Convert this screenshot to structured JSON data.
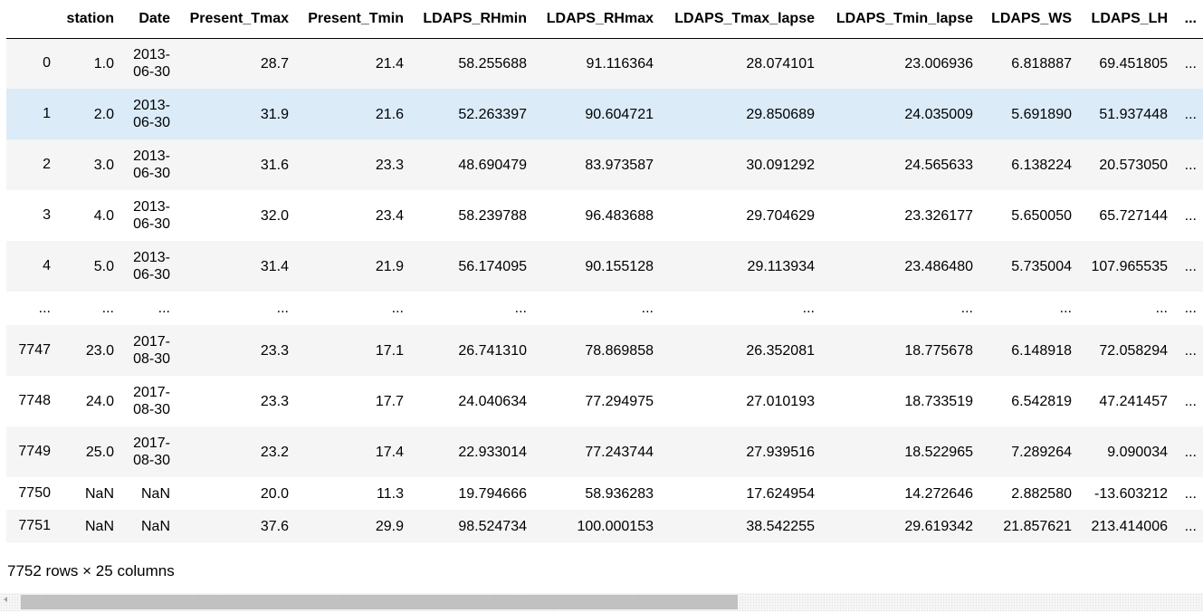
{
  "table": {
    "columns": [
      "station",
      "Date",
      "Present_Tmax",
      "Present_Tmin",
      "LDAPS_RHmin",
      "LDAPS_RHmax",
      "LDAPS_Tmax_lapse",
      "LDAPS_Tmin_lapse",
      "LDAPS_WS",
      "LDAPS_LH",
      "..."
    ],
    "rows": [
      {
        "index": "0",
        "station": "1.0",
        "date1": "2013-",
        "date2": "06-30",
        "tmax": "28.7",
        "tmin": "21.4",
        "rhmin": "58.255688",
        "rhmax": "91.116364",
        "tmaxl": "28.074101",
        "tminl": "23.006936",
        "ws": "6.818887",
        "lh": "69.451805",
        "more": "..."
      },
      {
        "index": "1",
        "station": "2.0",
        "date1": "2013-",
        "date2": "06-30",
        "tmax": "31.9",
        "tmin": "21.6",
        "rhmin": "52.263397",
        "rhmax": "90.604721",
        "tmaxl": "29.850689",
        "tminl": "24.035009",
        "ws": "5.691890",
        "lh": "51.937448",
        "more": "..."
      },
      {
        "index": "2",
        "station": "3.0",
        "date1": "2013-",
        "date2": "06-30",
        "tmax": "31.6",
        "tmin": "23.3",
        "rhmin": "48.690479",
        "rhmax": "83.973587",
        "tmaxl": "30.091292",
        "tminl": "24.565633",
        "ws": "6.138224",
        "lh": "20.573050",
        "more": "..."
      },
      {
        "index": "3",
        "station": "4.0",
        "date1": "2013-",
        "date2": "06-30",
        "tmax": "32.0",
        "tmin": "23.4",
        "rhmin": "58.239788",
        "rhmax": "96.483688",
        "tmaxl": "29.704629",
        "tminl": "23.326177",
        "ws": "5.650050",
        "lh": "65.727144",
        "more": "..."
      },
      {
        "index": "4",
        "station": "5.0",
        "date1": "2013-",
        "date2": "06-30",
        "tmax": "31.4",
        "tmin": "21.9",
        "rhmin": "56.174095",
        "rhmax": "90.155128",
        "tmaxl": "29.113934",
        "tminl": "23.486480",
        "ws": "5.735004",
        "lh": "107.965535",
        "more": "..."
      },
      {
        "index": "...",
        "station": "...",
        "date1": "...",
        "date2": "",
        "tmax": "...",
        "tmin": "...",
        "rhmin": "...",
        "rhmax": "...",
        "tmaxl": "...",
        "tminl": "...",
        "ws": "...",
        "lh": "...",
        "more": "..."
      },
      {
        "index": "7747",
        "station": "23.0",
        "date1": "2017-",
        "date2": "08-30",
        "tmax": "23.3",
        "tmin": "17.1",
        "rhmin": "26.741310",
        "rhmax": "78.869858",
        "tmaxl": "26.352081",
        "tminl": "18.775678",
        "ws": "6.148918",
        "lh": "72.058294",
        "more": "..."
      },
      {
        "index": "7748",
        "station": "24.0",
        "date1": "2017-",
        "date2": "08-30",
        "tmax": "23.3",
        "tmin": "17.7",
        "rhmin": "24.040634",
        "rhmax": "77.294975",
        "tmaxl": "27.010193",
        "tminl": "18.733519",
        "ws": "6.542819",
        "lh": "47.241457",
        "more": "..."
      },
      {
        "index": "7749",
        "station": "25.0",
        "date1": "2017-",
        "date2": "08-30",
        "tmax": "23.2",
        "tmin": "17.4",
        "rhmin": "22.933014",
        "rhmax": "77.243744",
        "tmaxl": "27.939516",
        "tminl": "18.522965",
        "ws": "7.289264",
        "lh": "9.090034",
        "more": "..."
      },
      {
        "index": "7750",
        "station": "NaN",
        "date1": "NaN",
        "date2": "",
        "tmax": "20.0",
        "tmin": "11.3",
        "rhmin": "19.794666",
        "rhmax": "58.936283",
        "tmaxl": "17.624954",
        "tminl": "14.272646",
        "ws": "2.882580",
        "lh": "-13.603212",
        "more": "..."
      },
      {
        "index": "7751",
        "station": "NaN",
        "date1": "NaN",
        "date2": "",
        "tmax": "37.6",
        "tmin": "29.9",
        "rhmin": "98.524734",
        "rhmax": "100.000153",
        "tmaxl": "38.542255",
        "tminl": "29.619342",
        "ws": "21.857621",
        "lh": "213.414006",
        "more": "..."
      }
    ]
  },
  "footer": {
    "shape_text": "7752 rows × 25 columns"
  },
  "colors": {
    "row_stripe": "#f5f5f5",
    "row_hover": "#dbebf8",
    "scroll_thumb": "#c1c1c1"
  }
}
